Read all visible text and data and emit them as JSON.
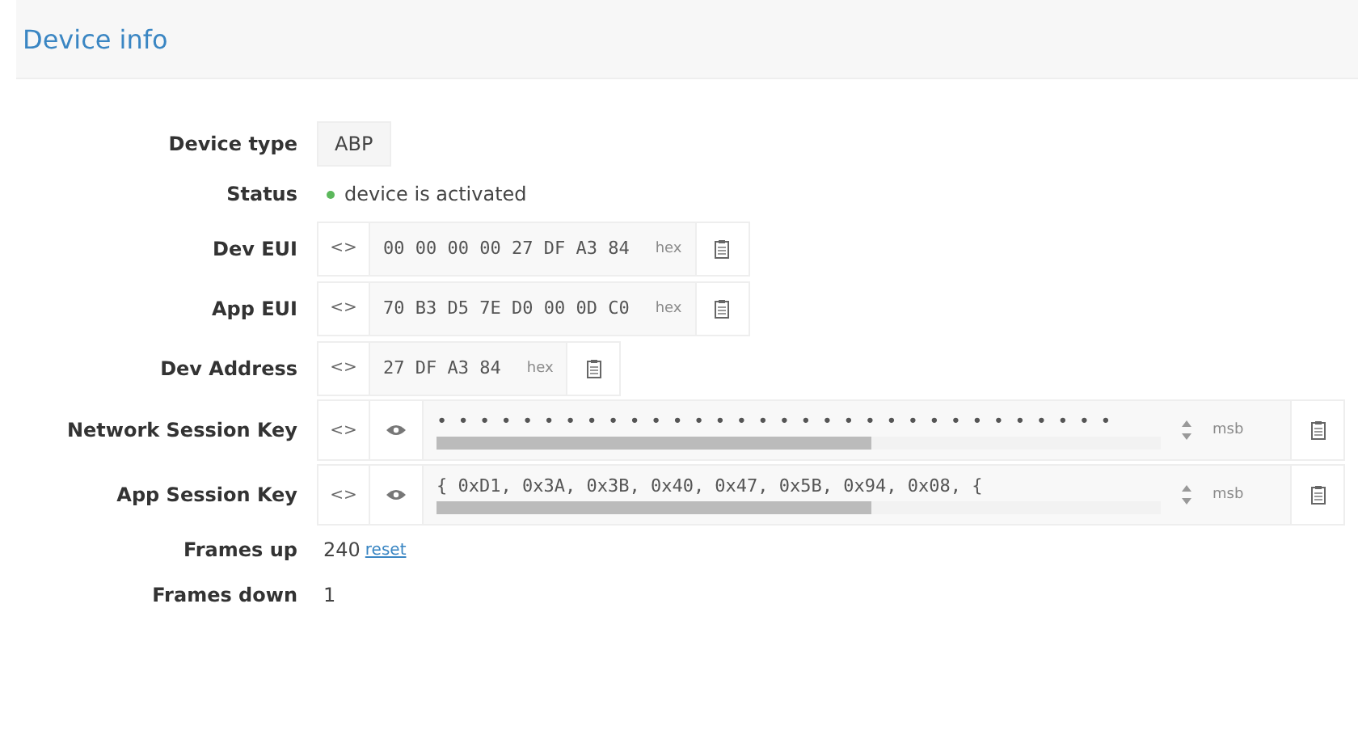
{
  "header": {
    "title": "Device info"
  },
  "rows": [
    {
      "kind": "badge",
      "label": "Device type",
      "value": "ABP"
    },
    {
      "kind": "status",
      "label": "Status",
      "value": "device is activated",
      "color": "#5cb85c"
    },
    {
      "kind": "hex",
      "label": "Dev EUI",
      "toggle": "<>",
      "value": "00 00 00 00 27 DF A3 84",
      "tag": "hex"
    },
    {
      "kind": "hex",
      "label": "App EUI",
      "toggle": "<>",
      "value": "70 B3 D5 7E D0 00 0D C0",
      "tag": "hex"
    },
    {
      "kind": "hex",
      "label": "Dev Address",
      "toggle": "<>",
      "value": "27 DF A3 84",
      "tag": "hex"
    },
    {
      "kind": "key",
      "label": "Network Session Key",
      "toggle": "<>",
      "value": "• • • • • • • • • • • • • • • • • • • • • • • • • • • • • • • •",
      "tag": "msb"
    },
    {
      "kind": "key",
      "label": "App Session Key",
      "toggle": "<>",
      "value": "{ 0xD1, 0x3A, 0x3B, 0x40, 0x47, 0x5B, 0x94, 0x08, {",
      "tag": "msb"
    },
    {
      "kind": "counter",
      "label": "Frames up",
      "value": "240",
      "link": "reset"
    },
    {
      "kind": "counter",
      "label": "Frames down",
      "value": "1"
    }
  ]
}
